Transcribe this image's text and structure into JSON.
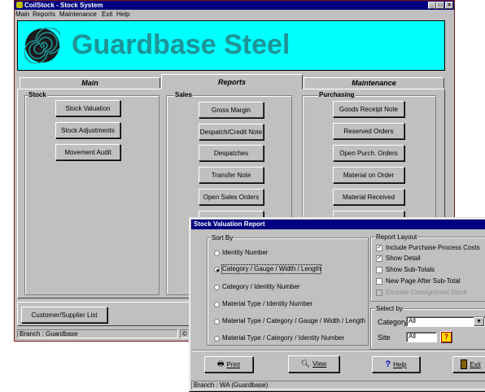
{
  "main_window": {
    "title": "CoilStock - Stock System",
    "controls": {
      "minimize": "_",
      "maximize": "□",
      "close": "×"
    },
    "menu": [
      "Main",
      "Reports",
      "Maintenance",
      "Exit",
      "Help"
    ],
    "banner": {
      "company": "Guardbase Steel",
      "background": "#00ffff",
      "text_color": "#1e9496"
    },
    "tabs": [
      "Main",
      "Reports",
      "Maintenance"
    ],
    "groups": {
      "stock": {
        "label": "Stock",
        "buttons": [
          "Stock Valuation",
          "Stock Adjustments",
          "Movement Audit"
        ]
      },
      "sales": {
        "label": "Sales",
        "buttons": [
          "Gross Margin",
          "Despatch/Credit Note",
          "Despatches",
          "Transfer Note",
          "Open Sales Orders"
        ]
      },
      "purchasing": {
        "label": "Purchasing",
        "buttons": [
          "Goods Receipt Note",
          "Reserved Orders",
          "Open Purch. Orders",
          "Material on Order",
          "Material Received"
        ]
      }
    },
    "customer_supplier_button": "Customer/Supplier List",
    "status": {
      "branch": "Branch : Guardbase",
      "copyright": "© Gu"
    }
  },
  "dialog": {
    "title": "Stock Valuation Report",
    "sort_by": {
      "label": "Sort By",
      "options": [
        "Identity Number",
        "Category / Gauge / Width / Length",
        "Category / Identity Number",
        "Material Type / Identity Number",
        "Material Type / Category / Gauge / Width / Length",
        "Material Type / Category / Identity Number"
      ],
      "selected_index": 1
    },
    "report_layout": {
      "label": "Report Layout",
      "options": [
        {
          "label": "Include Purchase Process Costs",
          "checked": true,
          "enabled": true
        },
        {
          "label": "Show Detail",
          "checked": true,
          "enabled": true
        },
        {
          "label": "Show Sub-Totals",
          "checked": false,
          "enabled": true
        },
        {
          "label": "New Page After Sub-Total",
          "checked": false,
          "enabled": true
        },
        {
          "label": "Exclude Consignment Stock",
          "checked": false,
          "enabled": false
        }
      ]
    },
    "select_by": {
      "label": "Select by",
      "category_label": "Category",
      "category_value": "All",
      "site_label": "Site",
      "site_value": "All",
      "help_glyph": "?"
    },
    "buttons": {
      "print": "Print",
      "view": "View",
      "help": "Help",
      "exit": "Exit"
    },
    "status": "Branch : WA (Guardbase)"
  }
}
